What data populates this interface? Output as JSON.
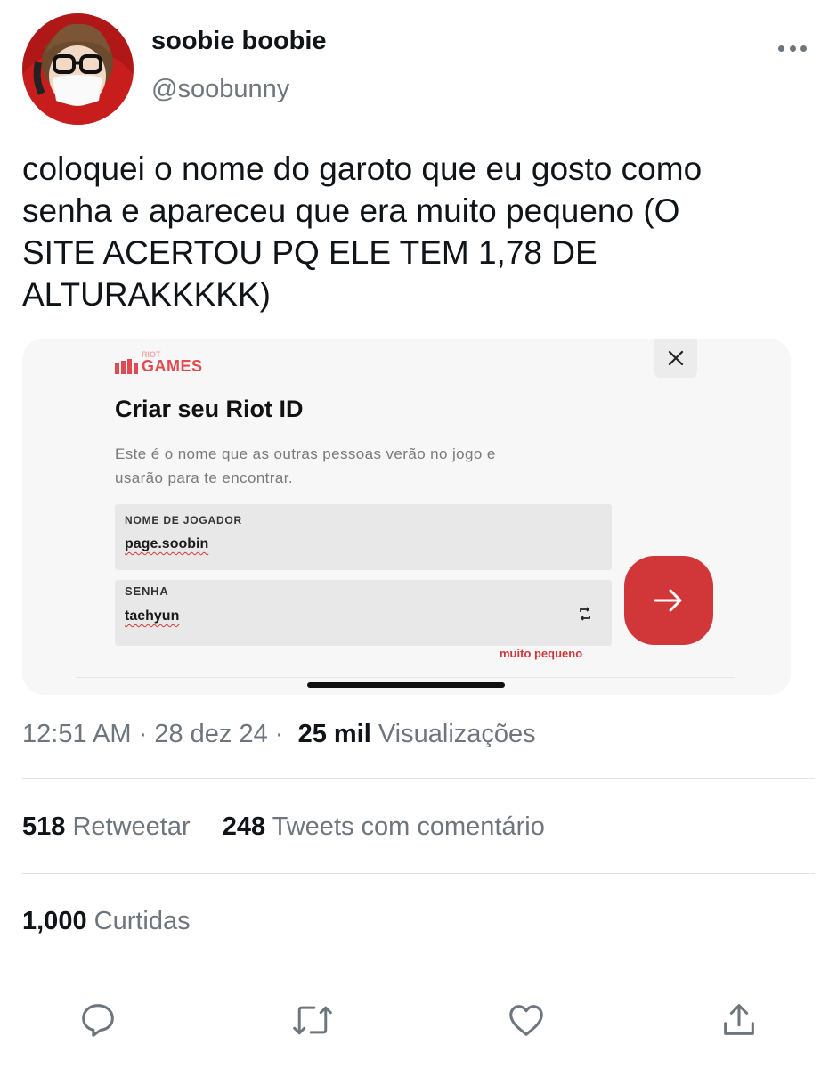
{
  "author": {
    "name": "soobie boobie",
    "handle": "@soobunny"
  },
  "tweet": {
    "text_lines": [
      "coloquei o nome do garoto que eu gosto como",
      "senha e apareceu que era muito pequeno (O",
      "SITE ACERTOU PQ ELE TEM 1,78 DE",
      "ALTURAKKKKK)"
    ]
  },
  "embedded_image": {
    "brand_small": "RIOT",
    "brand": "GAMES",
    "title": "Criar seu Riot ID",
    "description_lines": [
      "Este é o nome que as outras pessoas verão no jogo e",
      "usarão para te encontrar."
    ],
    "player_field": {
      "label": "NOME DE JOGADOR",
      "value": "page.soobin"
    },
    "password_field": {
      "label": "SENHA",
      "value": "taehyun"
    },
    "error": "muito pequeno",
    "accent_color": "#d13639"
  },
  "meta": {
    "time": "12:51 AM",
    "date": "28 dez 24",
    "separator": "·",
    "views_count": "25 mil",
    "views_label": "Visualizações"
  },
  "stats": {
    "retweets_count": "518",
    "retweets_label": "Retweetar",
    "quotes_count": "248",
    "quotes_label": "Tweets com comentário",
    "likes_count": "1,000",
    "likes_label": "Curtidas"
  },
  "actions": [
    "reply-icon",
    "retweet-icon",
    "like-icon",
    "share-icon"
  ]
}
